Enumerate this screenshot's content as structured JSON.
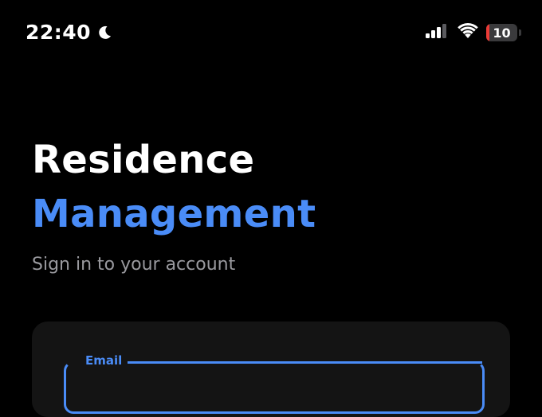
{
  "status_bar": {
    "time": "22:40",
    "focus_icon": "moon-icon",
    "signal_icon": "cellular-signal-icon",
    "signal_bars_active": 3,
    "signal_bars_total": 4,
    "wifi_icon": "wifi-icon",
    "battery_level": "10",
    "battery_fraction": 0.1,
    "battery_color": "#eb3b36"
  },
  "header": {
    "title_line1": "Residence",
    "title_line2": "Management",
    "subtitle": "Sign in to your account"
  },
  "colors": {
    "background": "#000000",
    "accent": "#4a8cf7",
    "title_text": "#ffffff",
    "subtitle_text": "#9a9a9f",
    "card_background": "#141414"
  },
  "login_form": {
    "email_label": "Email",
    "email_value": "",
    "email_placeholder": ""
  }
}
